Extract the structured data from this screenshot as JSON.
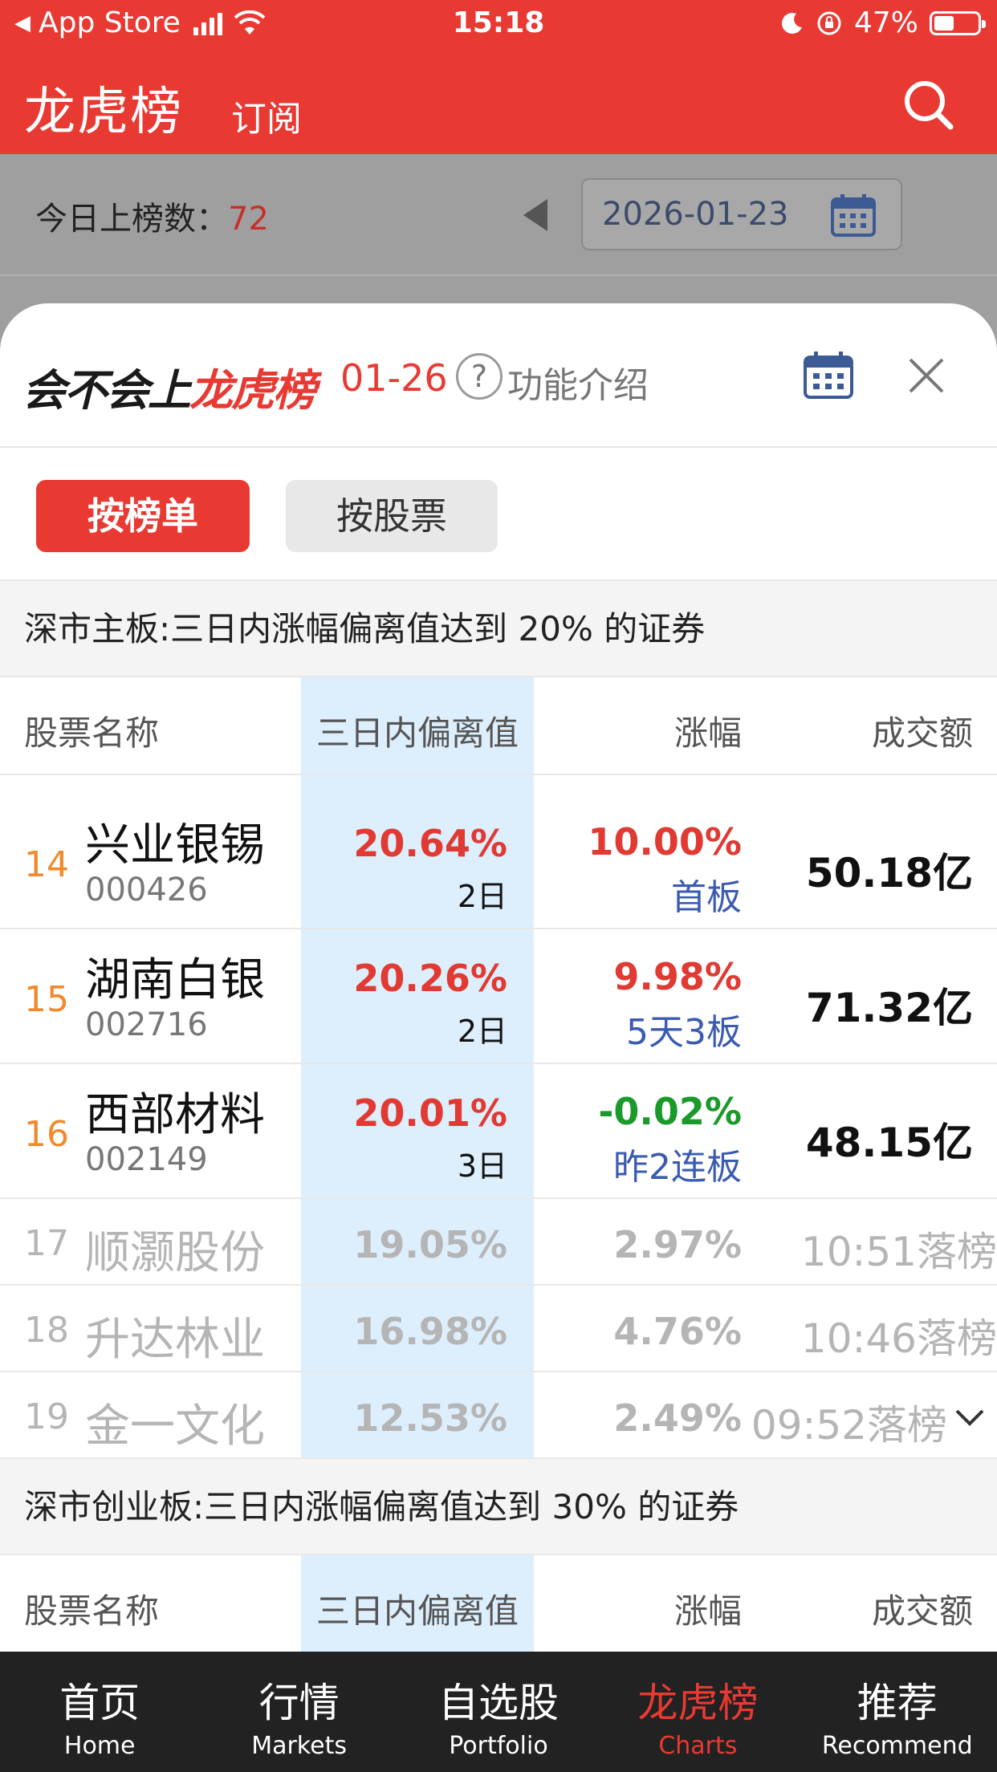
{
  "status_bar": {
    "back_label": "App Store",
    "time": "15:18",
    "battery": "47%",
    "battery_level": 0.47
  },
  "header": {
    "title": "龙虎榜",
    "subscribe": "订阅"
  },
  "background": {
    "count_label": "今日上榜数：",
    "count_value": "72",
    "date": "2026-01-23"
  },
  "sheet": {
    "title_black": "会不会上",
    "title_red": "龙虎榜",
    "date": "01-26",
    "help_mark": "?",
    "help_text": "功能介绍",
    "tabs": [
      "按榜单",
      "按股票"
    ],
    "section1_title": "深市主板:三日内涨幅偏离值达到 20% 的证券",
    "section2_title": "深市创业板:三日内涨幅偏离值达到 30% 的证券",
    "columns": {
      "name": "股票名称",
      "deviation": "三日内偏离值",
      "change": "涨幅",
      "turnover": "成交额"
    },
    "rows": [
      {
        "rank": "14",
        "name": "兴业银锡",
        "code": "000426",
        "dev": "20.64%",
        "days": "2日",
        "chg": "10.00%",
        "board": "首板",
        "amt": "50.18亿"
      },
      {
        "rank": "15",
        "name": "湖南白银",
        "code": "002716",
        "dev": "20.26%",
        "days": "2日",
        "chg": "9.98%",
        "board": "5天3板",
        "amt": "71.32亿"
      },
      {
        "rank": "16",
        "name": "西部材料",
        "code": "002149",
        "dev": "20.01%",
        "days": "3日",
        "chg": "-0.02%",
        "board": "昨2连板",
        "amt": "48.15亿"
      }
    ],
    "dim_rows": [
      {
        "rank": "17",
        "name": "顺灏股份",
        "dev": "19.05%",
        "chg": "2.97%",
        "amt": "10:51落榜"
      },
      {
        "rank": "18",
        "name": "升达林业",
        "dev": "16.98%",
        "chg": "4.76%",
        "amt": "10:46落榜"
      },
      {
        "rank": "19",
        "name": "金一文化",
        "dev": "12.53%",
        "chg": "2.49%",
        "amt": "09:52落榜"
      }
    ]
  },
  "tabbar": [
    {
      "cn": "首页",
      "en": "Home"
    },
    {
      "cn": "行情",
      "en": "Markets"
    },
    {
      "cn": "自选股",
      "en": "Portfolio"
    },
    {
      "cn": "龙虎榜",
      "en": "Charts"
    },
    {
      "cn": "推荐",
      "en": "Recommend"
    }
  ],
  "colors": {
    "brand_red": "#e83a33",
    "up_red": "#e03a33",
    "down_green": "#1a9a2a",
    "board_blue": "#3a5bb0",
    "rank_orange": "#f08a2c",
    "highlight_col": "#ddeefc"
  }
}
